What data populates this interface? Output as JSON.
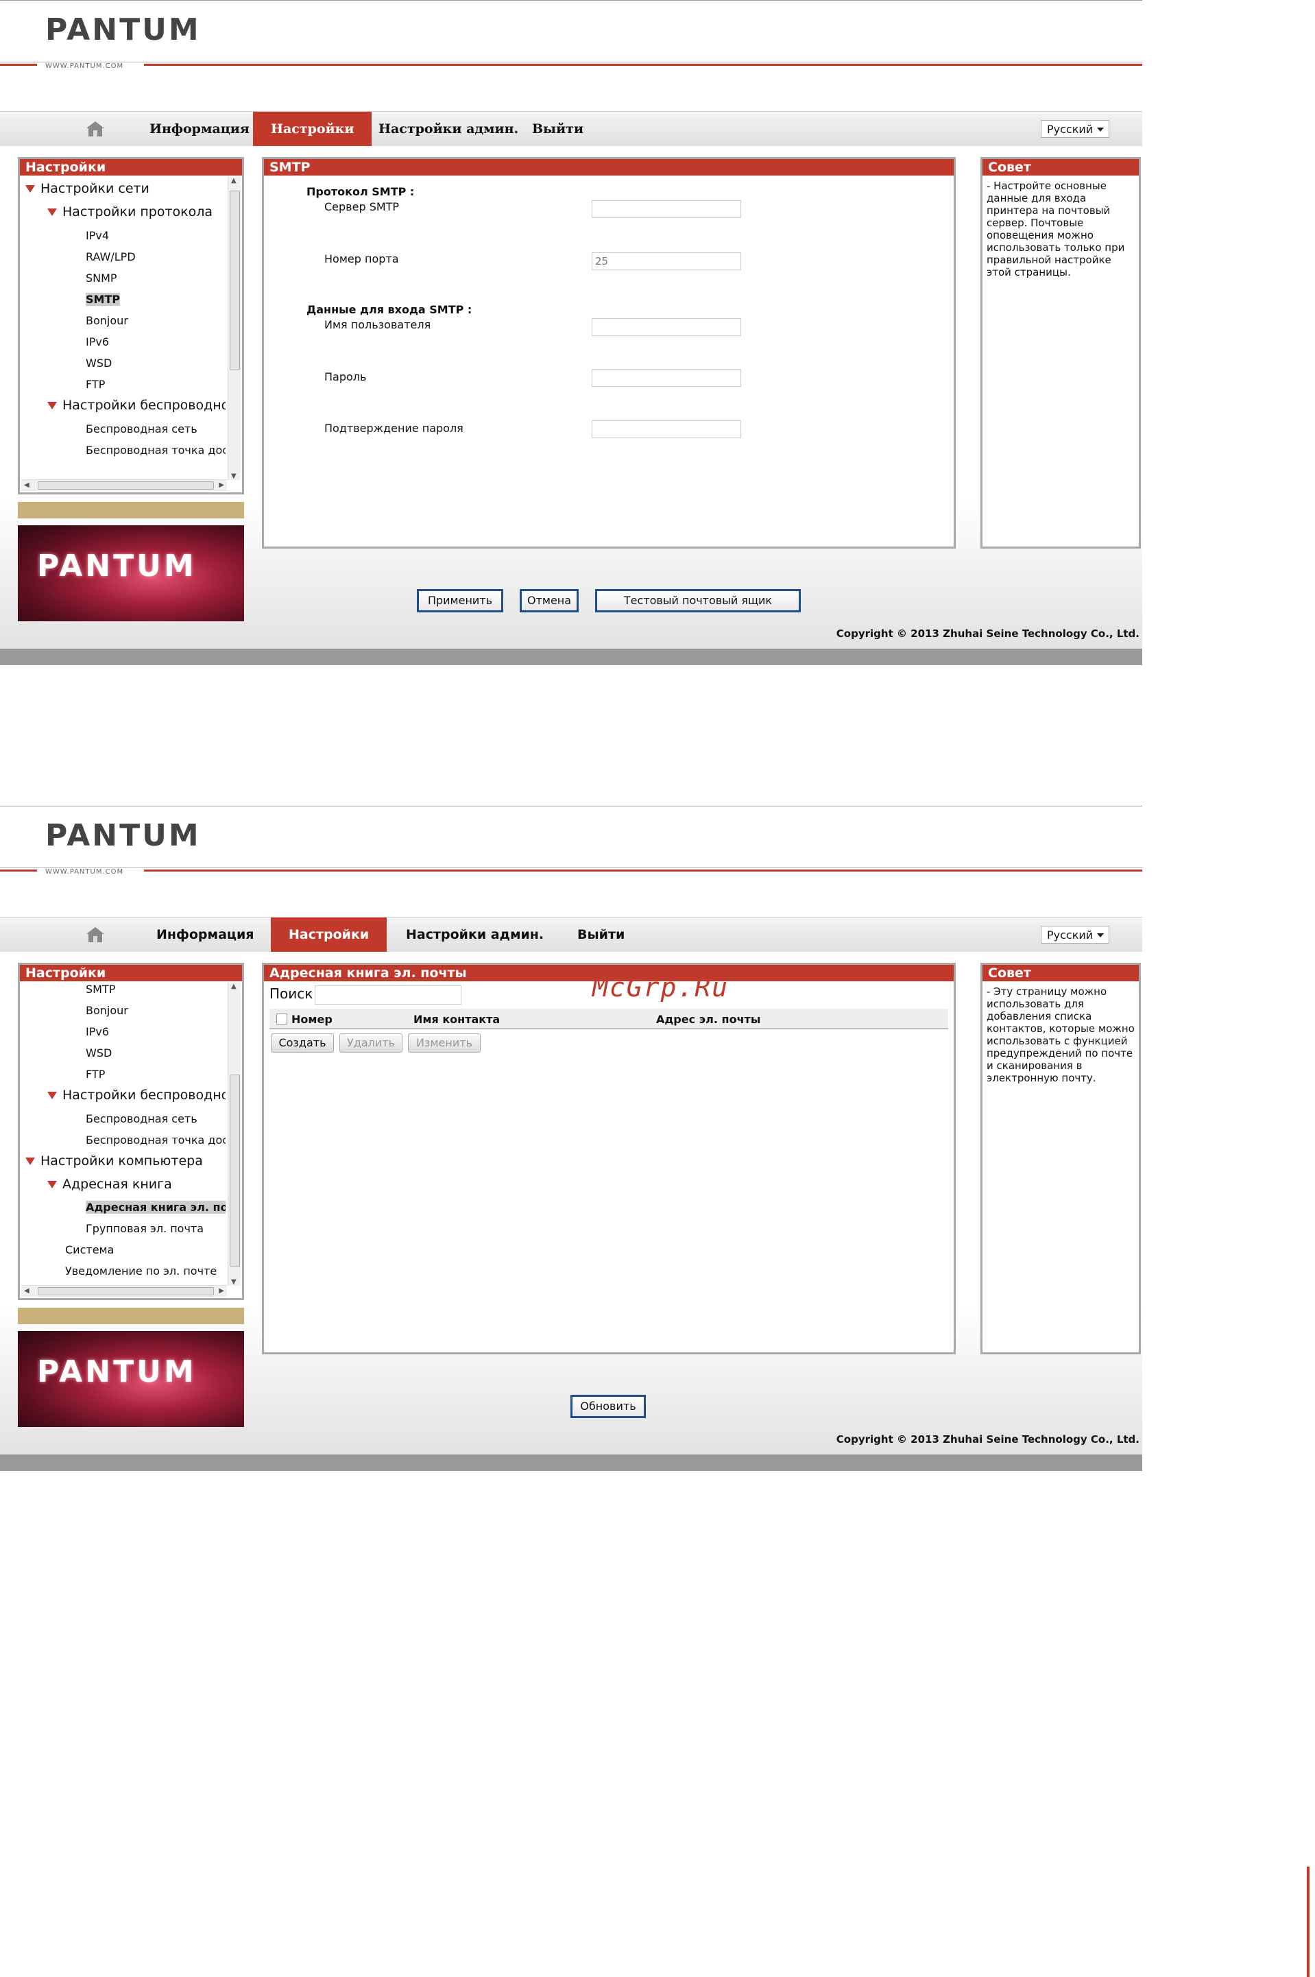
{
  "brand": {
    "logo": "PANTUM",
    "url": "WWW.PANTUM.COM",
    "banner": "PANTUM"
  },
  "nav": {
    "items": [
      "Информация",
      "Настройки",
      "Настройки админ.",
      "Выйти"
    ],
    "active": "Настройки",
    "language": "Русский"
  },
  "watermark": "McGrp.Ru",
  "screen1": {
    "sidebar": {
      "title": "Настройки",
      "items": [
        "Настройки сети",
        "Настройки протокола",
        "IPv4",
        "RAW/LPD",
        "SNMP",
        "SMTP",
        "Bonjour",
        "IPv6",
        "WSD",
        "FTP",
        "Настройки беспроводной с",
        "Беспроводная сеть",
        "Беспроводная точка досту"
      ]
    },
    "content": {
      "title": "SMTP",
      "protocol_header": "Протокол SMTP :",
      "server_label": "Сервер SMTP",
      "server_value": "",
      "port_label": "Номер порта",
      "port_value": "25",
      "login_header": "Данные для входа SMTP :",
      "username_label": "Имя пользователя",
      "password_label": "Пароль",
      "confirm_label": "Подтверждение пароля"
    },
    "buttons": {
      "apply": "Применить",
      "cancel": "Отмена",
      "test": "Тестовый почтовый ящик"
    },
    "tips": {
      "title": "Совет",
      "text": "- Настройте основные данные для входа принтера на почтовый сервер. Почтовые оповещения можно использовать только при правильной настройке этой страницы."
    },
    "copyright": "Copyright © 2013 Zhuhai Seine Technology Co., Ltd."
  },
  "screen2": {
    "sidebar": {
      "title": "Настройки",
      "items": [
        "SMTP",
        "Bonjour",
        "IPv6",
        "WSD",
        "FTP",
        "Настройки беспроводной с",
        "Беспроводная сеть",
        "Беспроводная точка досту",
        "Настройки компьютера",
        "Адресная книга",
        "Адресная книга эл. поч",
        "Групповая эл. почта",
        "Система",
        "Уведомление по эл. почте"
      ]
    },
    "content": {
      "title": "Адресная книга эл. почты",
      "search_label": "Поиск",
      "columns": [
        "Номер",
        "Имя контакта",
        "Адрес эл. почты"
      ],
      "create": "Создать",
      "delete": "Удалить",
      "edit": "Изменить"
    },
    "buttons": {
      "refresh": "Обновить"
    },
    "tips": {
      "title": "Совет",
      "text": "- Эту страницу можно использовать для добавления списка контактов, которые можно использовать с функцией предупреждений по почте и сканирования в электронную почту."
    },
    "copyright": "Copyright © 2013 Zhuhai Seine Technology Co., Ltd."
  }
}
